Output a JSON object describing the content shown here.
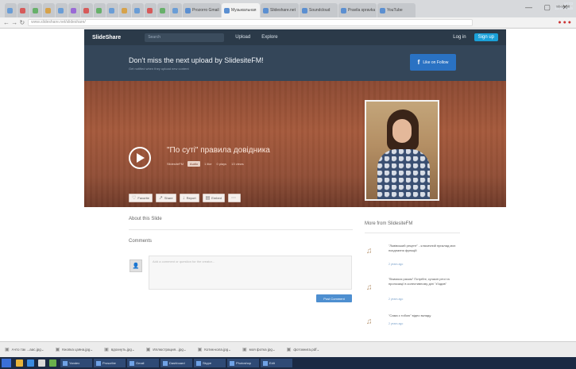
{
  "browser": {
    "tabs": [
      {
        "label": "",
        "color": "#6a9dd6"
      },
      {
        "label": "",
        "color": "#d65a5a"
      },
      {
        "label": "",
        "color": "#67b06a"
      },
      {
        "label": "",
        "color": "#d6a24a"
      },
      {
        "label": "",
        "color": "#6a9dd6"
      },
      {
        "label": "",
        "color": "#9a6ad6"
      },
      {
        "label": "",
        "color": "#d65a5a"
      },
      {
        "label": "",
        "color": "#67b06a"
      },
      {
        "label": "",
        "color": "#6a9dd6"
      },
      {
        "label": "",
        "color": "#d6a24a"
      },
      {
        "label": "",
        "color": "#6a9dd6"
      },
      {
        "label": "",
        "color": "#d65a5a"
      },
      {
        "label": "",
        "color": "#67b06a"
      },
      {
        "label": "",
        "color": "#6a9dd6"
      }
    ],
    "wide_tabs": [
      "Prozorro Gmail",
      "Музыкальная",
      "Slideshare.net",
      "Soundcloud",
      "Pravila spravka",
      "YouTube"
    ],
    "window_controls": "— ▢ ✕",
    "url": "www.slideshare.net/slideshare/",
    "nav_glyphs": "← → ↻"
  },
  "site": {
    "logo": "SlideShare",
    "search_placeholder": "Search",
    "nav_upload": "Upload",
    "nav_explore": "Explore",
    "login": "Log in",
    "signup": "Sign up"
  },
  "banner": {
    "title": "Don't miss the next upload by SlidesiteFM!",
    "subtitle": "Get notified when they upload new content",
    "follow_icon": "f",
    "follow_label": "Like on Follow"
  },
  "hero": {
    "title": "\"По суті\" правила довідника",
    "author": "SlidesiteFM",
    "tag": "Audio",
    "meta": [
      "1 like",
      "0 plays",
      "13 views"
    ],
    "actions": [
      {
        "icon": "♡",
        "label": "Favorite"
      },
      {
        "icon": "↗",
        "label": "Share"
      },
      {
        "icon": "↓",
        "label": "Report"
      },
      {
        "icon": "▤",
        "label": "Embed"
      },
      {
        "icon": "⋯",
        "label": ""
      }
    ]
  },
  "content": {
    "about_heading": "About this Slide",
    "comments_heading": "Comments",
    "comment_placeholder": "Add a comment or question for the creator...",
    "post_button": "Post Comment"
  },
  "more_from": {
    "heading": "More from SlidesiteFM",
    "items": [
      {
        "title": "\"Львівський рецепт\" - класичний приклад моє поєднання функцій",
        "date": "2 years ago"
      },
      {
        "title": "\"Вчимося разом\" Потрібні, сучасні речі та пропозиції в колективному ділі \"з'їздив\"",
        "date": "2 years ago"
      },
      {
        "title": "\"Сама з тобою\" відео вкладу",
        "date": "2 years ago"
      }
    ]
  },
  "downloads": {
    "items": [
      "Ачто так ...aac.jpg",
      "Кнопка цзяна.jpg",
      "вдохнуть.jpg",
      "Иллюстрация...jpg",
      "Котик-кола.jpg",
      "моя фотка jpg",
      "фотокнига.pdf"
    ],
    "show_all": "Show all"
  },
  "taskbar": {
    "icon_colors": [
      "#e8b33a",
      "#3b8be0",
      "#d9d9d9",
      "#6ab04c"
    ],
    "buttons": [
      "Yandex",
      "Proscribe",
      "Gmail",
      "Dashboard",
      "Skype",
      "Photoshop",
      "Edit"
    ],
    "time": "14:23",
    "date": "23.07.2015"
  }
}
